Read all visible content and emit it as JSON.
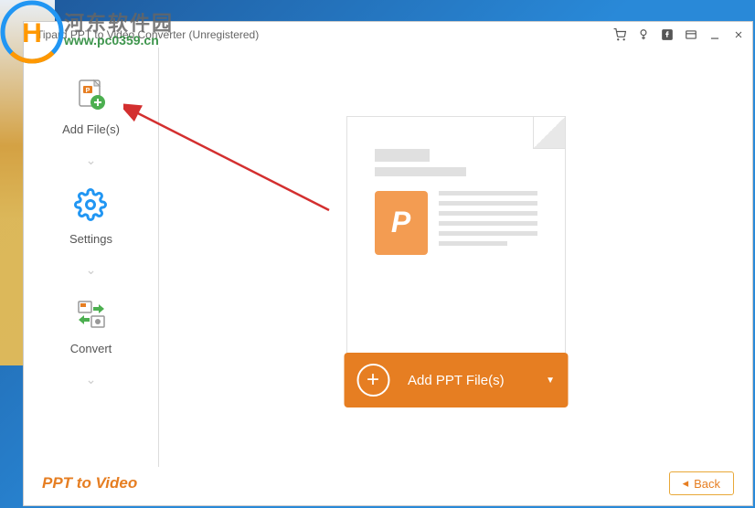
{
  "window": {
    "title": "Tipard PPT to Video Converter (Unregistered)"
  },
  "sidebar": {
    "items": [
      {
        "label": "Add File(s)"
      },
      {
        "label": "Settings"
      },
      {
        "label": "Convert"
      }
    ]
  },
  "main": {
    "add_button_label": "Add PPT File(s)",
    "p_icon_letter": "P"
  },
  "footer": {
    "brand": "PPT to Video",
    "back_label": "Back"
  },
  "watermark": {
    "text": "河东软件园",
    "url": "www.pc0359.cn"
  }
}
